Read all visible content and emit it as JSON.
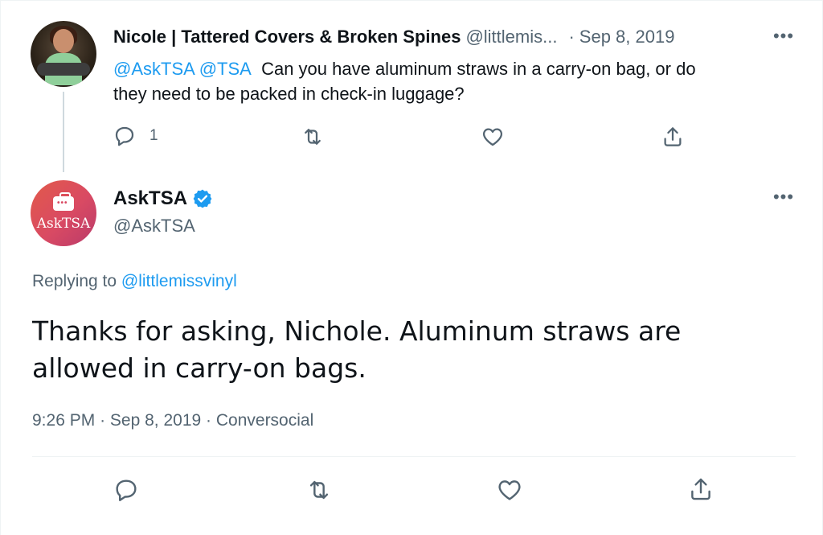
{
  "parent_tweet": {
    "display_name": "Nicole | Tattered Covers & Broken Spines",
    "handle": "@littlemis...",
    "separator": "·",
    "date": "Sep 8, 2019",
    "more_label": "•••",
    "mentions": [
      "@AskTSA",
      "@TSA"
    ],
    "text_line1": "Can you have aluminum straws in a carry-on bag, or do",
    "text_line2": "they need to be packed in check-in luggage?",
    "reply_count": "1"
  },
  "reply_tweet": {
    "display_name": "AskTSA",
    "handle": "@AskTSA",
    "avatar_text": "AskTSA",
    "more_label": "•••",
    "replying_prefix": "Replying to",
    "replying_to": "@littlemissvinyl",
    "text": "Thanks for asking, Nichole. Aluminum straws are allowed in carry-on bags.",
    "time": "9:26 PM",
    "date": "Sep 8, 2019",
    "source": "Conversocial",
    "separator": "·"
  },
  "colors": {
    "accent": "#1d9bf0",
    "secondary_text": "#536471",
    "primary_text": "#0f1419",
    "border": "#eff3f4"
  },
  "icons": [
    "reply-icon",
    "retweet-icon",
    "like-icon",
    "share-icon",
    "verified-badge-icon",
    "more-icon"
  ]
}
